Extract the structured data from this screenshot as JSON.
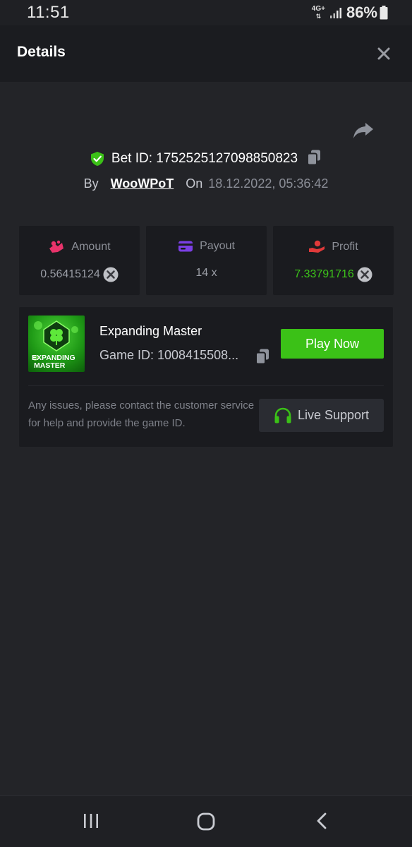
{
  "status_bar": {
    "time": "11:51",
    "network": "4G+",
    "battery": "86%"
  },
  "header": {
    "title": "Details"
  },
  "bet": {
    "id_label": "Bet ID: 1752525127098850823",
    "by_label": "By",
    "username": "WooWPoT",
    "on_label": "On",
    "date": "18.12.2022, 05:36:42"
  },
  "stats": {
    "amount": {
      "label": "Amount",
      "value": "0.56415124"
    },
    "payout": {
      "label": "Payout",
      "value": "14 x"
    },
    "profit": {
      "label": "Profit",
      "value": "7.33791716"
    }
  },
  "game": {
    "name": "Expanding Master",
    "id_label": "Game ID: 1008415508...",
    "thumb_text_line1": "EXPANDING",
    "thumb_text_line2": "MASTER",
    "play_label": "Play Now",
    "support_text": "Any issues, please contact the customer service for help and provide the game ID.",
    "support_label": "Live Support"
  },
  "colors": {
    "accent_green": "#3bc117",
    "profit_green": "#3dc41a",
    "amount_icon": "#e8336b",
    "payout_icon": "#7b3fe4",
    "profit_icon": "#e03a3a",
    "background": "#232428",
    "card": "#1a1b1f"
  },
  "icons": [
    "close-icon",
    "share-icon",
    "shield-check-icon",
    "copy-icon",
    "amount-icon",
    "payout-card-icon",
    "profit-hand-icon",
    "coin-x-icon",
    "headset-icon",
    "recents-icon",
    "home-icon",
    "back-icon"
  ]
}
